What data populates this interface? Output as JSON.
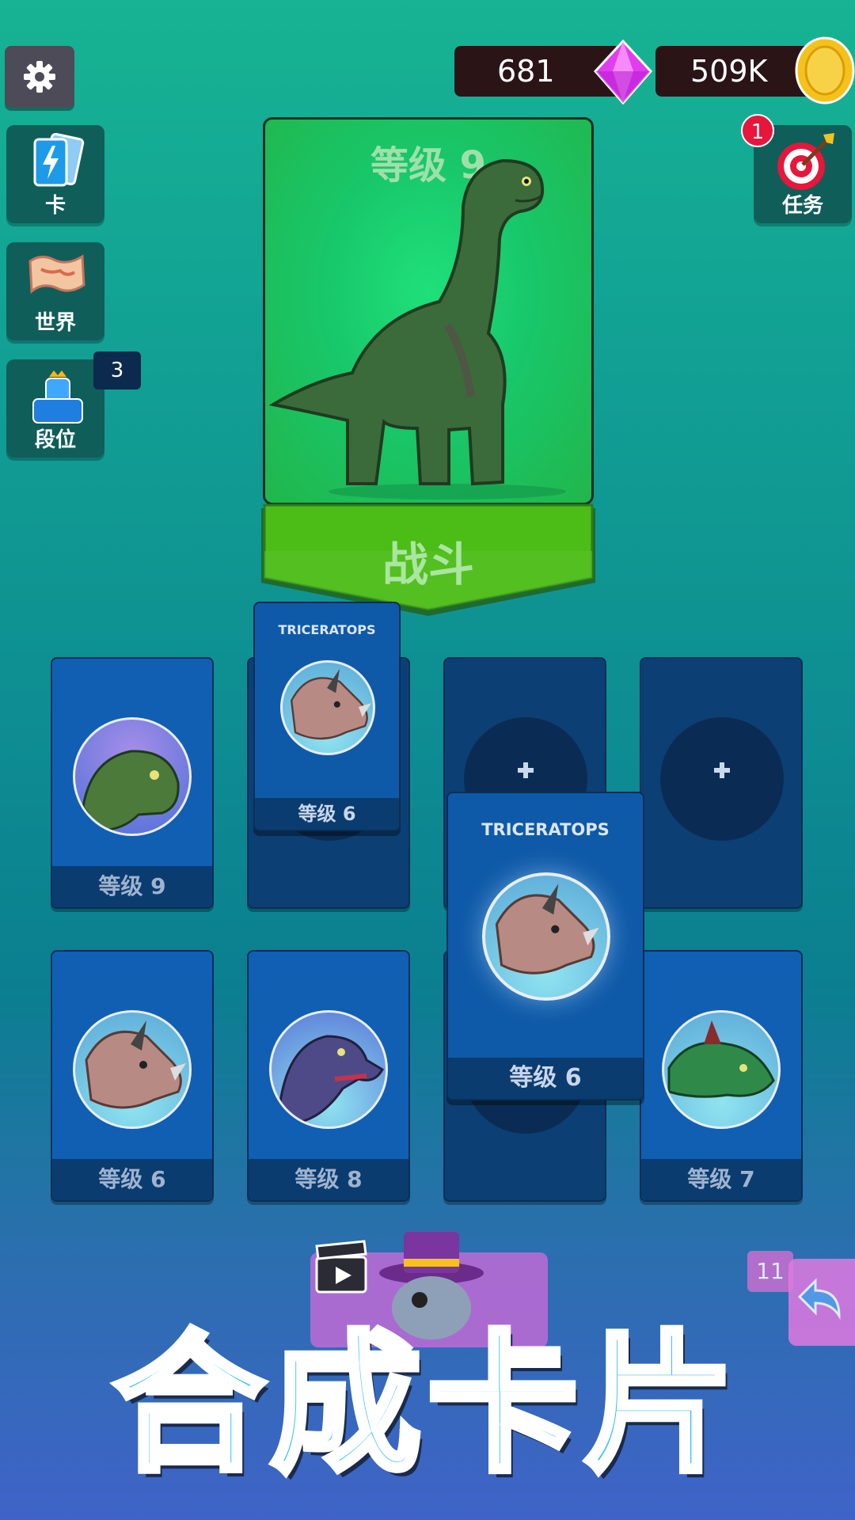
{
  "topbar": {
    "gems": "681",
    "coins": "509K"
  },
  "sidebar": {
    "cards_label": "卡",
    "world_label": "世界",
    "rank_label": "段位",
    "rank_badge": "3"
  },
  "missions": {
    "label": "任务",
    "badge": "1"
  },
  "hero_card": {
    "level": "等级 9",
    "fight_label": "战斗"
  },
  "slots": [
    {
      "level": "等级 9",
      "creature": "green-longneck-icon"
    },
    {
      "level": "",
      "creature": "empty"
    },
    {
      "level": "",
      "creature": "empty"
    },
    {
      "level": "",
      "creature": "empty"
    },
    {
      "level": "等级 6",
      "creature": "triceratops-icon"
    },
    {
      "level": "等级 8",
      "creature": "purple-raptor-icon"
    },
    {
      "level": "",
      "creature": "empty"
    },
    {
      "level": "等级 7",
      "creature": "green-stegosaur-icon"
    }
  ],
  "dragged_cards": [
    {
      "name": "TRICERATOPS",
      "level": "等级 6"
    },
    {
      "name": "TRICERATOPS",
      "level": "等级 6"
    }
  ],
  "bottom": {
    "undo_count": "11",
    "headline": "合成卡片"
  },
  "colors": {
    "gem": "#e23cf0",
    "coin": "#f5c21b",
    "fight_green": "#4cbc17",
    "badge_red": "#e6163c"
  }
}
